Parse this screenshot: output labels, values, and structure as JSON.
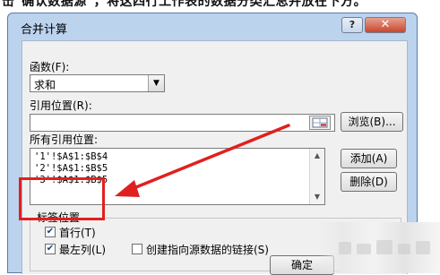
{
  "topstrip_text": "击\"确认数据源\"，将这四行工作表的数据分类汇总并放在下方。",
  "dialog": {
    "title": "合并计算",
    "help_label": "?",
    "close_label": "✕",
    "function_label": "函数(F):",
    "function_value": "求和",
    "reference_label": "引用位置(R):",
    "reference_value": "",
    "browse_button": "浏览(B)...",
    "all_references_label": "所有引用位置:",
    "references": [
      "'1'!$A$1:$B$4",
      "'2'!$A$1:$B$5",
      "'3'!$A$1:$B$5"
    ],
    "add_button": "添加(A)",
    "delete_button": "删除(D)",
    "label_group_title": "标签位置",
    "top_row_label": "首行(T)",
    "top_row_checked": true,
    "left_column_label": "最左列(L)",
    "left_column_checked": true,
    "link_label": "创建指向源数据的链接(S)",
    "link_checked": false,
    "ok_button": "确定"
  },
  "colors": {
    "highlight": "#e02020",
    "window_frame": "#bcd3ee"
  }
}
